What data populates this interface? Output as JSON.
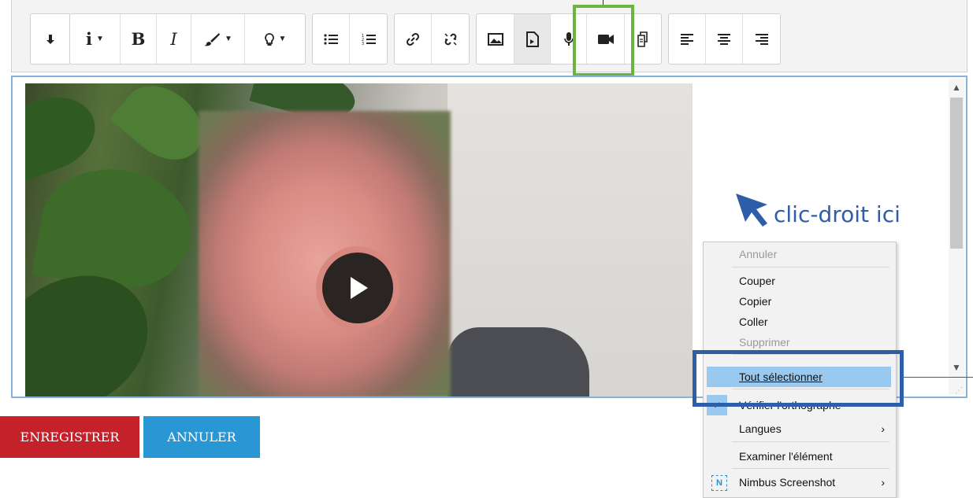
{
  "toolbar": {
    "groups": [
      {
        "items": [
          "collapse"
        ]
      },
      {
        "items": [
          "info",
          "bold",
          "italic",
          "brush",
          "lightbulb"
        ],
        "bold_label": "B",
        "italic_label": "I",
        "info_label": "i"
      },
      {
        "items": [
          "unordered-list",
          "ordered-list"
        ]
      },
      {
        "items": [
          "link",
          "unlink"
        ]
      },
      {
        "items": [
          "image",
          "media",
          "record-audio",
          "record-video",
          "manage-files"
        ]
      },
      {
        "items": [
          "align-left",
          "align-center",
          "align-right"
        ]
      }
    ],
    "highlighted_button": "record-video",
    "highlight_color": "#6cb33f"
  },
  "editor": {
    "content": "video",
    "border_color": "#89b3d9"
  },
  "annotation": {
    "text": "clic-droit ici",
    "color": "#2e5ea8"
  },
  "buttons": {
    "save_label": "ENREGISTRER",
    "cancel_label": "ANNULER",
    "save_color": "#c4212b",
    "cancel_color": "#2897d4"
  },
  "context_menu": {
    "items": [
      {
        "label": "Annuler",
        "disabled": true
      },
      {
        "label": "Couper",
        "disabled": false
      },
      {
        "label": "Copier",
        "disabled": false
      },
      {
        "label": "Coller",
        "disabled": false
      },
      {
        "label": "Supprimer",
        "disabled": true
      },
      {
        "label": "Tout sélectionner",
        "disabled": false,
        "highlighted": true
      },
      {
        "label": "Vérifier l'orthographe",
        "checked": true
      },
      {
        "label": "Langues",
        "submenu": true
      },
      {
        "label": "Examiner l'élément",
        "disabled": false
      },
      {
        "label": "Nimbus Screenshot",
        "submenu": true,
        "icon": "N"
      }
    ],
    "highlight_box_color": "#2d5ea8"
  }
}
